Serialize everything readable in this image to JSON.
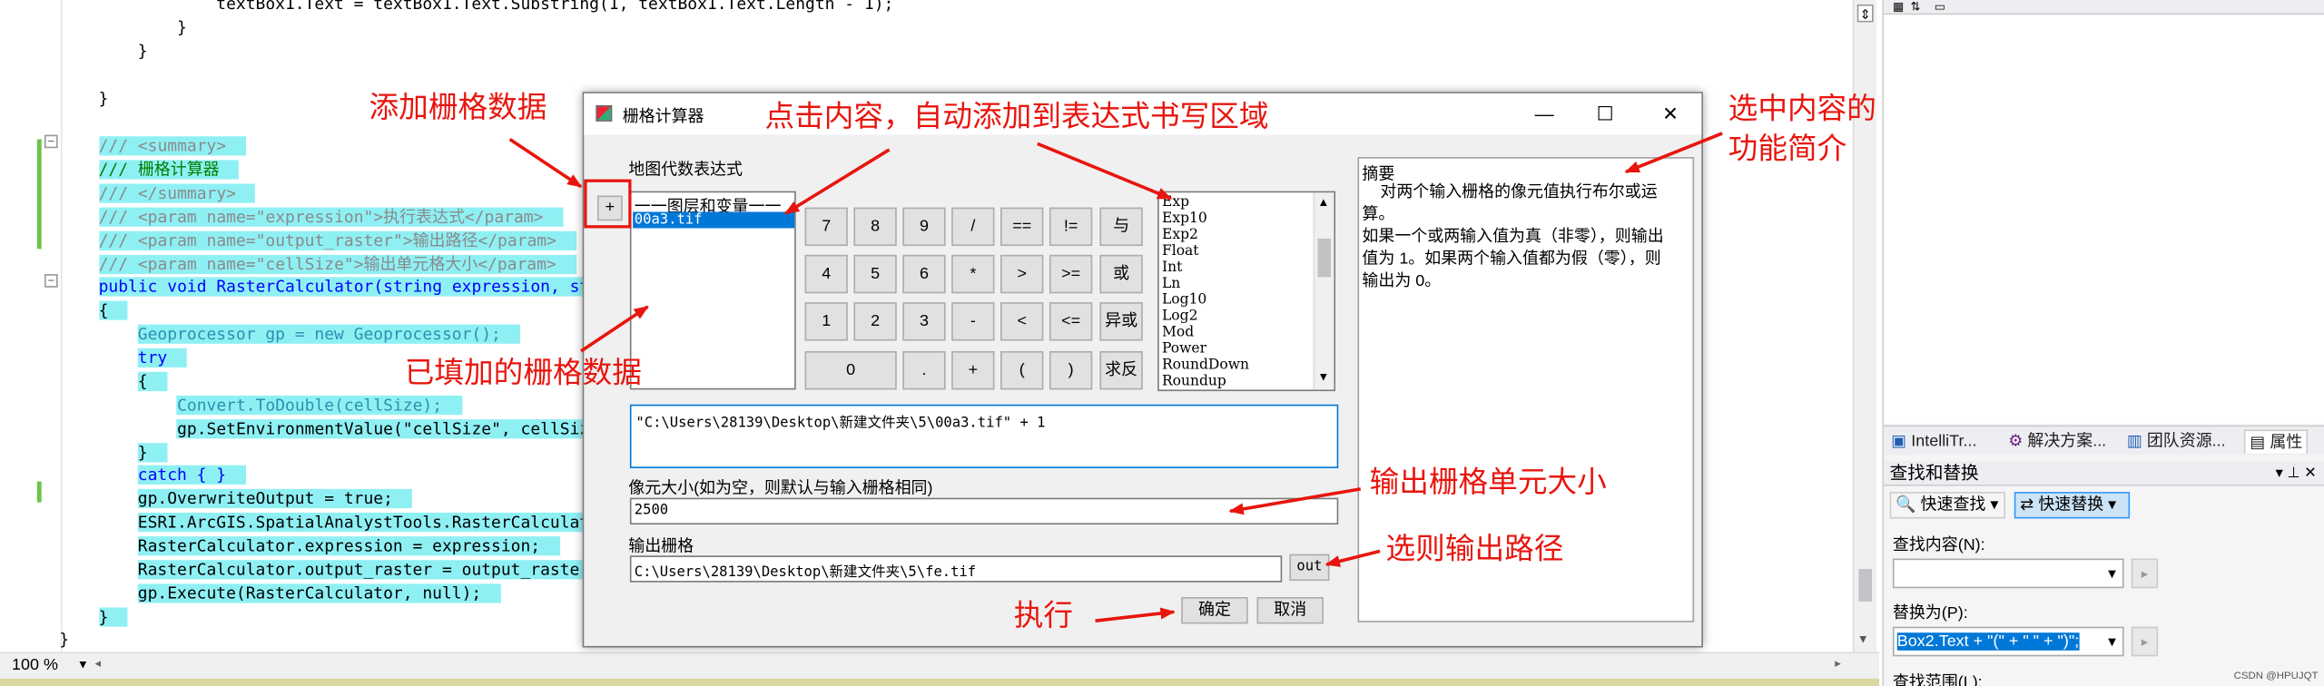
{
  "editor": {
    "lines": [
      {
        "text": "                textBox1.Text = textBox1.Text.Substring(1, textBox1.Text.Length - 1);",
        "cls": "",
        "hl": false
      },
      {
        "text": "            }",
        "cls": "",
        "hl": false
      },
      {
        "text": "        }",
        "cls": "",
        "hl": false
      },
      {
        "text": "",
        "cls": "",
        "hl": false
      },
      {
        "text": "    }",
        "cls": "",
        "hl": false
      },
      {
        "text": "",
        "cls": "",
        "hl": false
      },
      {
        "text": "    /// <summary>",
        "cls": "cm",
        "hl": true
      },
      {
        "text": "    /// 栅格计算器",
        "cls": "cn",
        "hl": true
      },
      {
        "text": "    /// </summary>",
        "cls": "cm",
        "hl": true
      },
      {
        "text": "    /// <param name=\"expression\">执行表达式</param>",
        "cls": "cm",
        "hl": true
      },
      {
        "text": "    /// <param name=\"output_raster\">输出路径</param>",
        "cls": "cm",
        "hl": true
      },
      {
        "text": "    /// <param name=\"cellSize\">输出单元格大小</param>",
        "cls": "cm",
        "hl": true
      },
      {
        "text": "    public void RasterCalculator(string expression, st",
        "cls": "kwline",
        "hl": true
      },
      {
        "text": "    {",
        "cls": "",
        "hl": true
      },
      {
        "text": "        Geoprocessor gp = new Geoprocessor();",
        "cls": "gpline",
        "hl": true
      },
      {
        "text": "        try",
        "cls": "kw",
        "hl": true
      },
      {
        "text": "        {",
        "cls": "",
        "hl": true
      },
      {
        "text": "            Convert.ToDouble(cellSize);",
        "cls": "cvline",
        "hl": true
      },
      {
        "text": "            gp.SetEnvironmentValue(\"cellSize\", cellSiz",
        "cls": "envline",
        "hl": true
      },
      {
        "text": "        }",
        "cls": "",
        "hl": true
      },
      {
        "text": "        catch { }",
        "cls": "kwcatch",
        "hl": true
      },
      {
        "text": "        gp.OverwriteOutput = true;",
        "cls": "owline",
        "hl": true
      },
      {
        "text": "        ESRI.ArcGIS.SpatialAnalystTools.RasterCalculat",
        "cls": "esline",
        "hl": true
      },
      {
        "text": "        RasterCalculator.expression = expression;",
        "cls": "",
        "hl": true
      },
      {
        "text": "        RasterCalculator.output_raster = output_raster",
        "cls": "",
        "hl": true
      },
      {
        "text": "        gp.Execute(RasterCalculator, null);",
        "cls": "exline",
        "hl": true
      },
      {
        "text": "    }",
        "cls": "",
        "hl": true
      },
      {
        "text": "}",
        "cls": "",
        "hl": false
      }
    ],
    "zoom": "100 %"
  },
  "right_panel": {
    "tabs": [
      "IntelliTr...",
      "解决方案...",
      "团队资源...",
      "属性"
    ],
    "find_replace_title": "查找和替换",
    "quick_find": "快速查找",
    "quick_replace": "快速替换",
    "find_label": "查找内容(N):",
    "find_value": "",
    "replace_label": "替换为(P):",
    "replace_value": "Box2.Text + \"(\" + \" \" + \")\";",
    "scope_label": "查找范围(L):",
    "title_controls": "▾ ⊥ ✕"
  },
  "dialog": {
    "title": "栅格计算器",
    "map_algebra_label": "地图代数表达式",
    "add_button": "+",
    "layer_list": [
      "一一图层和变量一一",
      "00a3.tif"
    ],
    "keypad": [
      [
        "7",
        "8",
        "9",
        "/",
        "==",
        "!=",
        "与"
      ],
      [
        "4",
        "5",
        "6",
        "*",
        ">",
        ">=",
        "或"
      ],
      [
        "1",
        "2",
        "3",
        "-",
        "<",
        "<=",
        "异或"
      ],
      [
        "0",
        ".",
        "+",
        "(",
        ")",
        "求反"
      ]
    ],
    "functions": [
      "Exp",
      "Exp10",
      "Exp2",
      "Float",
      "Int",
      "Ln",
      "Log10",
      "Log2",
      "Mod",
      "Power",
      "RoundDown",
      "Roundup"
    ],
    "summary_title": "摘要",
    "summary_text": "    对两个输入栅格的像元值执行布尔或运算。\n如果一个或两输入值为真（非零），则输出值为 1。如果两个输入值都为假（零），则输出为 0。",
    "expression": "\"C:\\Users\\28139\\Desktop\\新建文件夹\\5\\00a3.tif\" + 1",
    "cell_size_label": "像元大小(如为空，则默认与输入栅格相同)",
    "cell_size_value": "2500",
    "output_label": "输出栅格",
    "output_value": "C:\\Users\\28139\\Desktop\\新建文件夹\\5\\fe.tif",
    "out_button": "out",
    "ok_button": "确定",
    "cancel_button": "取消"
  },
  "annotations": {
    "add_raster": "添加栅格数据",
    "click_content": "点击内容，自动添加到表达式书写区域",
    "select_intro_1": "选中内容的",
    "select_intro_2": "功能简介",
    "added_raster": "已填加的栅格数据",
    "output_cell": "输出栅格单元大小",
    "select_output": "选则输出路径",
    "execute": "执行"
  },
  "watermark": "CSDN @HPUJQT",
  "colors": {
    "highlight": "#8ff0f4",
    "annotation": "#e8150e",
    "keyword": "#0000ff",
    "type": "#2b91af",
    "string": "#a31515",
    "selection": "#0078d7"
  }
}
